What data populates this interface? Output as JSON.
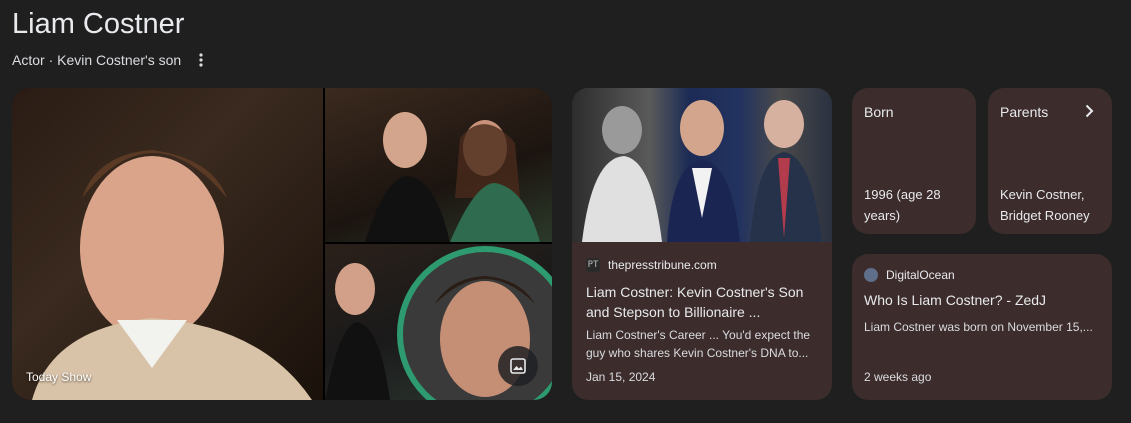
{
  "header": {
    "title": "Liam Costner",
    "subtitle": "Actor · Kevin Costner's son",
    "more_icon": "more-vert-icon"
  },
  "images": {
    "main_caption": "Today Show",
    "image_button_icon": "image-icon"
  },
  "article": {
    "source": "thepresstribune.com",
    "headline": "Liam Costner: Kevin Costner's Son and Stepson to Billionaire ...",
    "snippet": "Liam Costner's Career ... You'd expect the guy who shares Kevin Costner's DNA to...",
    "date": "Jan 15, 2024"
  },
  "facts": {
    "born_label": "Born",
    "born_value": "1996 (age 28 years)",
    "parents_label": "Parents",
    "parents_value": "Kevin Costner, Bridget Rooney",
    "parents_icon": "chevron-right-icon"
  },
  "small_article": {
    "source": "DigitalOcean",
    "headline": "Who Is Liam Costner? - ZedJ",
    "snippet": "Liam Costner was born on November 15,...",
    "date": "2 weeks ago"
  },
  "colors": {
    "background": "#1f1f1f",
    "card": "#3c2c2c",
    "text": "#e8eaed"
  }
}
